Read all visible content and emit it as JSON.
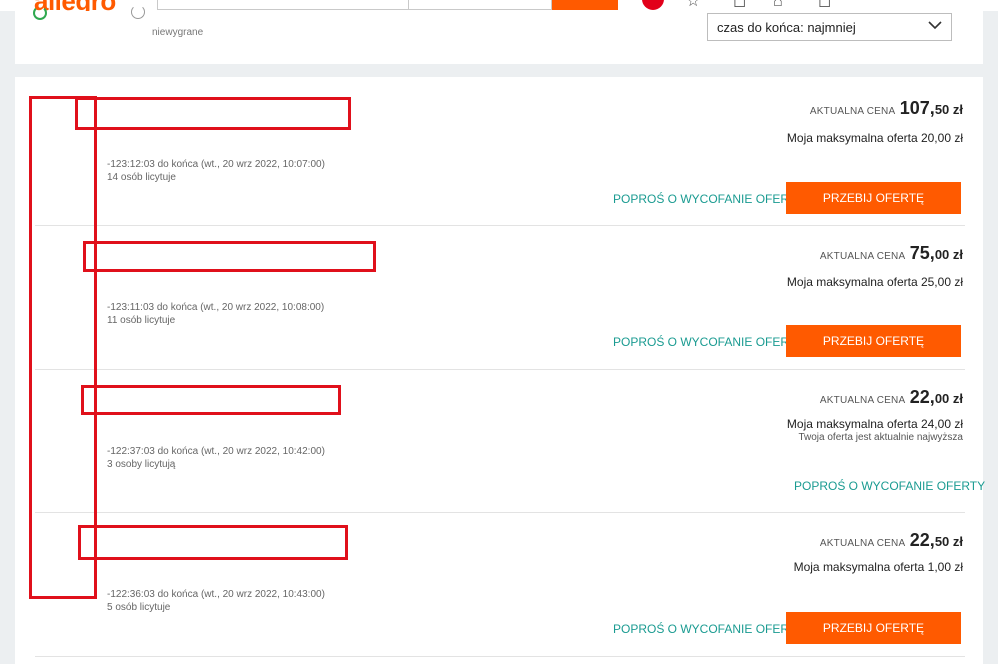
{
  "filter": {
    "status_label": "niewygrane",
    "sort_value": "czas do końca: najmniej"
  },
  "items": [
    {
      "time_left": "-123:12:03 do końca (wt., 20 wrz 2022, 10:07:00)",
      "bidders": "14 osób licytuje",
      "price_caption": "AKTUALNA CENA",
      "price_int": "107,",
      "price_dec": "50 zł",
      "max_offer": "Moja maksymalna oferta 20,00 zł",
      "withdraw": "POPROŚ O WYCOFANIE OFERTY",
      "outbid": "PRZEBIJ OFERTĘ"
    },
    {
      "time_left": "-123:11:03 do końca (wt., 20 wrz 2022, 10:08:00)",
      "bidders": "11 osób licytuje",
      "price_caption": "AKTUALNA CENA",
      "price_int": "75,",
      "price_dec": "00 zł",
      "max_offer": "Moja maksymalna oferta 25,00 zł",
      "withdraw": "POPROŚ O WYCOFANIE OFERTY",
      "outbid": "PRZEBIJ OFERTĘ"
    },
    {
      "time_left": "-122:37:03 do końca (wt., 20 wrz 2022, 10:42:00)",
      "bidders": "3 osoby licytują",
      "price_caption": "AKTUALNA CENA",
      "price_int": "22,",
      "price_dec": "00 zł",
      "max_offer": "Moja maksymalna oferta 24,00 zł",
      "note": "Twoja oferta jest aktualnie najwyższa",
      "withdraw": "POPROŚ O WYCOFANIE OFERTY"
    },
    {
      "time_left": "-122:36:03 do końca (wt., 20 wrz 2022, 10:43:00)",
      "bidders": "5 osób licytuje",
      "price_caption": "AKTUALNA CENA",
      "price_int": "22,",
      "price_dec": "50 zł",
      "max_offer": "Moja maksymalna oferta 1,00 zł",
      "withdraw": "POPROŚ O WYCOFANIE OFERTY",
      "outbid": "PRZEBIJ OFERTĘ"
    }
  ],
  "colors": {
    "brand": "#ff5a00",
    "link": "#1a9b91",
    "redaction": "#e0101b"
  },
  "icons": [
    "star-icon",
    "bell-icon",
    "cart-icon",
    "chevron-down-icon",
    "profile-icon"
  ]
}
